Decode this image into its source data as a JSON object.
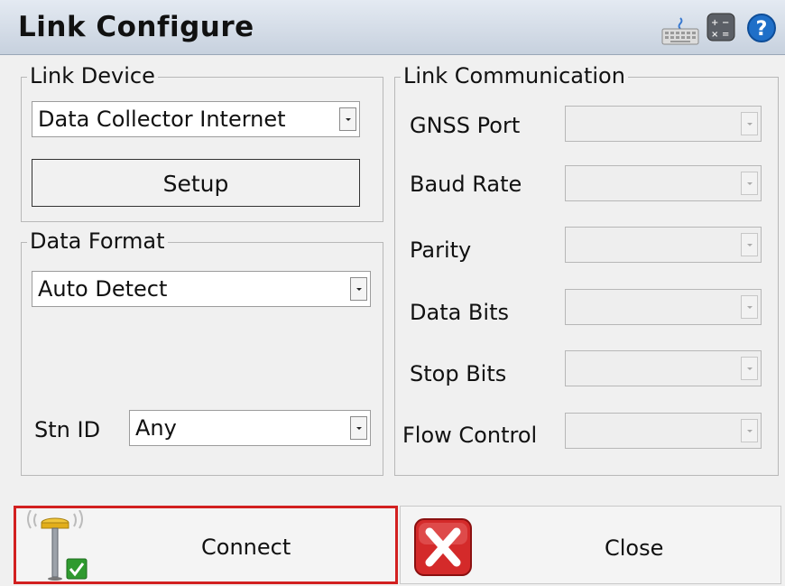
{
  "window": {
    "title": "Link Configure"
  },
  "toolbar_icons": [
    "keyboard-icon",
    "calculator-icon",
    "help-icon"
  ],
  "link_device": {
    "legend": "Link Device",
    "device_value": "Data Collector Internet",
    "setup_label": "Setup"
  },
  "data_format": {
    "legend": "Data Format",
    "format_value": "Auto Detect",
    "stn_id_label": "Stn ID",
    "stn_id_value": "Any"
  },
  "link_communication": {
    "legend": "Link Communication",
    "fields": [
      {
        "label": "GNSS Port",
        "value": ""
      },
      {
        "label": "Baud Rate",
        "value": ""
      },
      {
        "label": "Parity",
        "value": ""
      },
      {
        "label": "Data Bits",
        "value": ""
      },
      {
        "label": "Stop Bits",
        "value": ""
      },
      {
        "label": "Flow Control",
        "value": ""
      }
    ]
  },
  "actions": {
    "connect_label": "Connect",
    "close_label": "Close"
  },
  "colors": {
    "connect_highlight": "#d22020",
    "help_icon": "#1f6fc8",
    "close_icon": "#d42a2a",
    "check_badge": "#2f9a2f"
  }
}
